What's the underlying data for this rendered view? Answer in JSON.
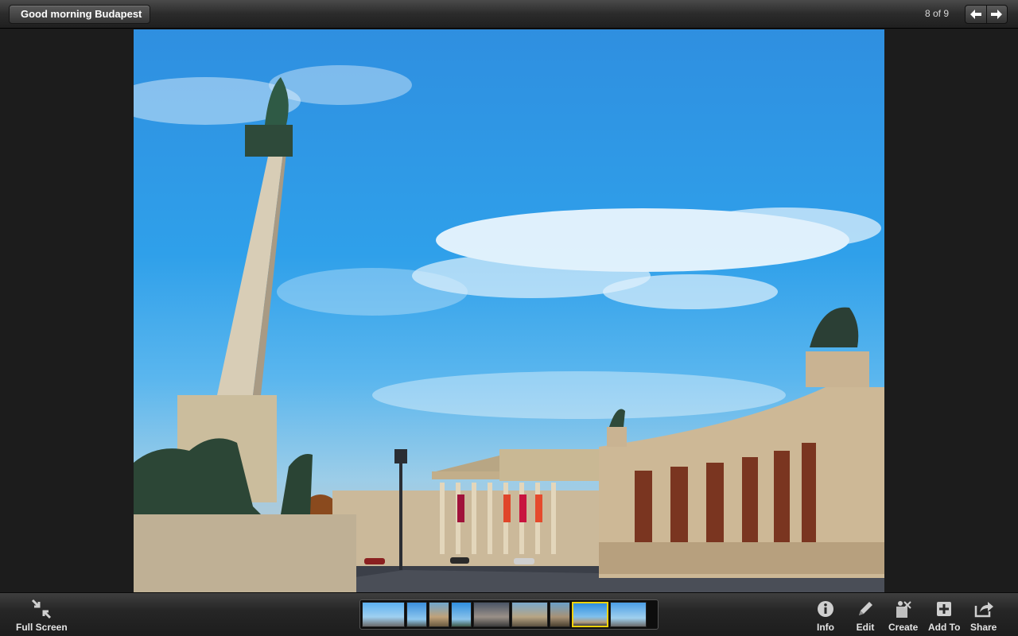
{
  "header": {
    "back_label": "Good morning Budapest",
    "counter": "8 of 9",
    "prev_icon": "arrow-left-icon",
    "next_icon": "arrow-right-icon"
  },
  "photo": {
    "subject": "heroes-square-photo"
  },
  "toolbar": {
    "fullscreen_label": "Full Screen",
    "info_label": "Info",
    "edit_label": "Edit",
    "create_label": "Create",
    "add_to_label": "Add To",
    "share_label": "Share"
  },
  "filmstrip": {
    "count": 9,
    "selected_index": 7
  },
  "colors": {
    "selection": "#f2d20b",
    "sky": "#2f9ae6"
  }
}
